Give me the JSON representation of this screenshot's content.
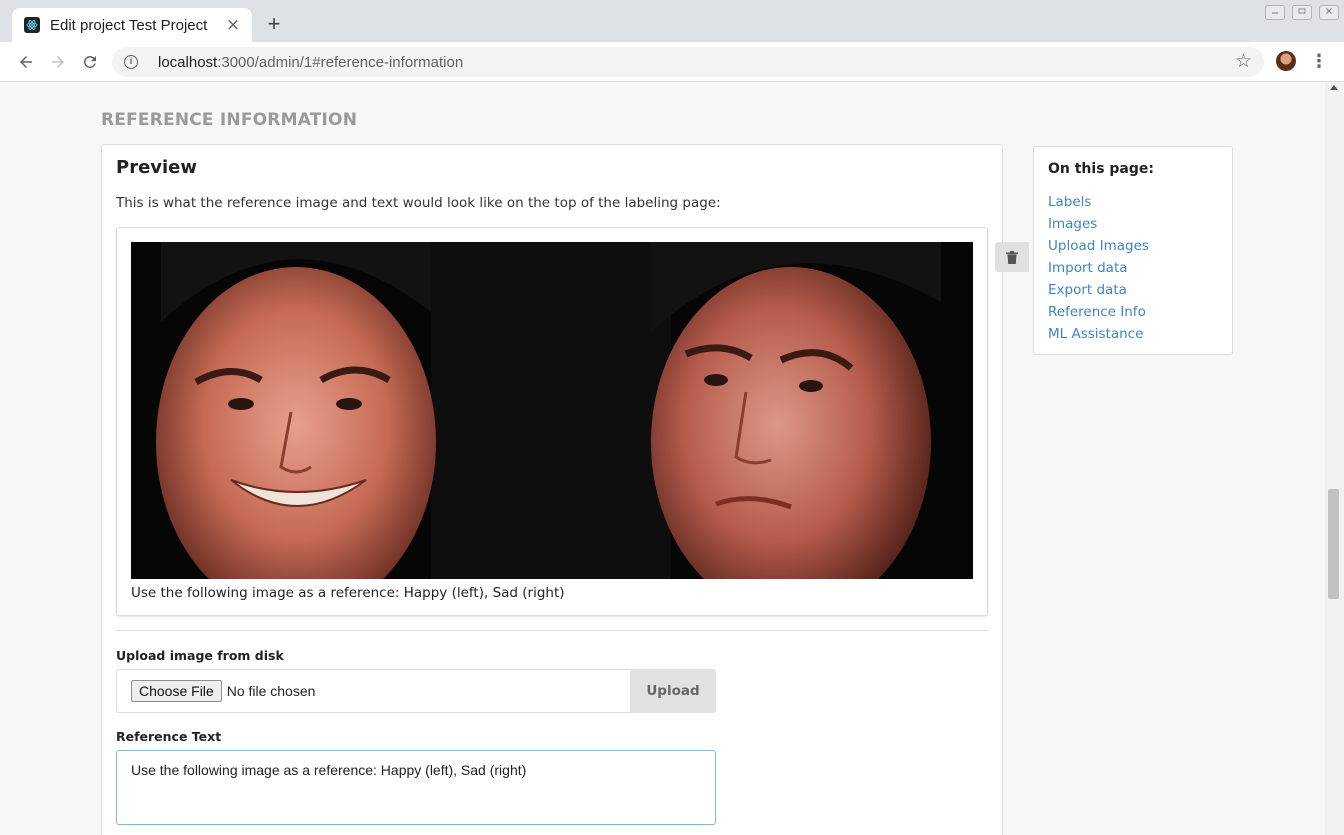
{
  "browser": {
    "tab_title": "Edit project Test Project",
    "tab_close": "×",
    "new_tab": "+",
    "url_host": "localhost",
    "url_path": ":3000/admin/1#reference-information",
    "icons": [
      "react-favicon-icon",
      "back-arrow-icon",
      "forward-arrow-icon",
      "reload-icon",
      "info-icon",
      "star-icon",
      "profile-avatar",
      "more-vert-icon",
      "minimize-icon",
      "restore-icon",
      "close-window-icon"
    ]
  },
  "page": {
    "section_heading": "REFERENCE INFORMATION",
    "preview": {
      "title": "Preview",
      "description": "This is what the reference image and text would look like on the top of the labeling page:",
      "caption": "Use the following image as a reference: Happy (left), Sad (right)"
    },
    "upload": {
      "label": "Upload image from disk",
      "choose_button": "Choose File",
      "file_status": "No file chosen",
      "upload_button": "Upload"
    },
    "reference_text": {
      "label": "Reference Text",
      "value": "Use the following image as a reference: Happy (left), Sad (right)"
    }
  },
  "sidebar": {
    "title": "On this page:",
    "items": [
      {
        "label": "Labels"
      },
      {
        "label": "Images"
      },
      {
        "label": "Upload Images"
      },
      {
        "label": "Import data"
      },
      {
        "label": "Export data"
      },
      {
        "label": "Reference Info"
      },
      {
        "label": "ML Assistance"
      }
    ]
  },
  "colors": {
    "link": "#4183c4",
    "heading_grey": "#9a9a9a",
    "textarea_focus_border": "#85b7d9"
  }
}
